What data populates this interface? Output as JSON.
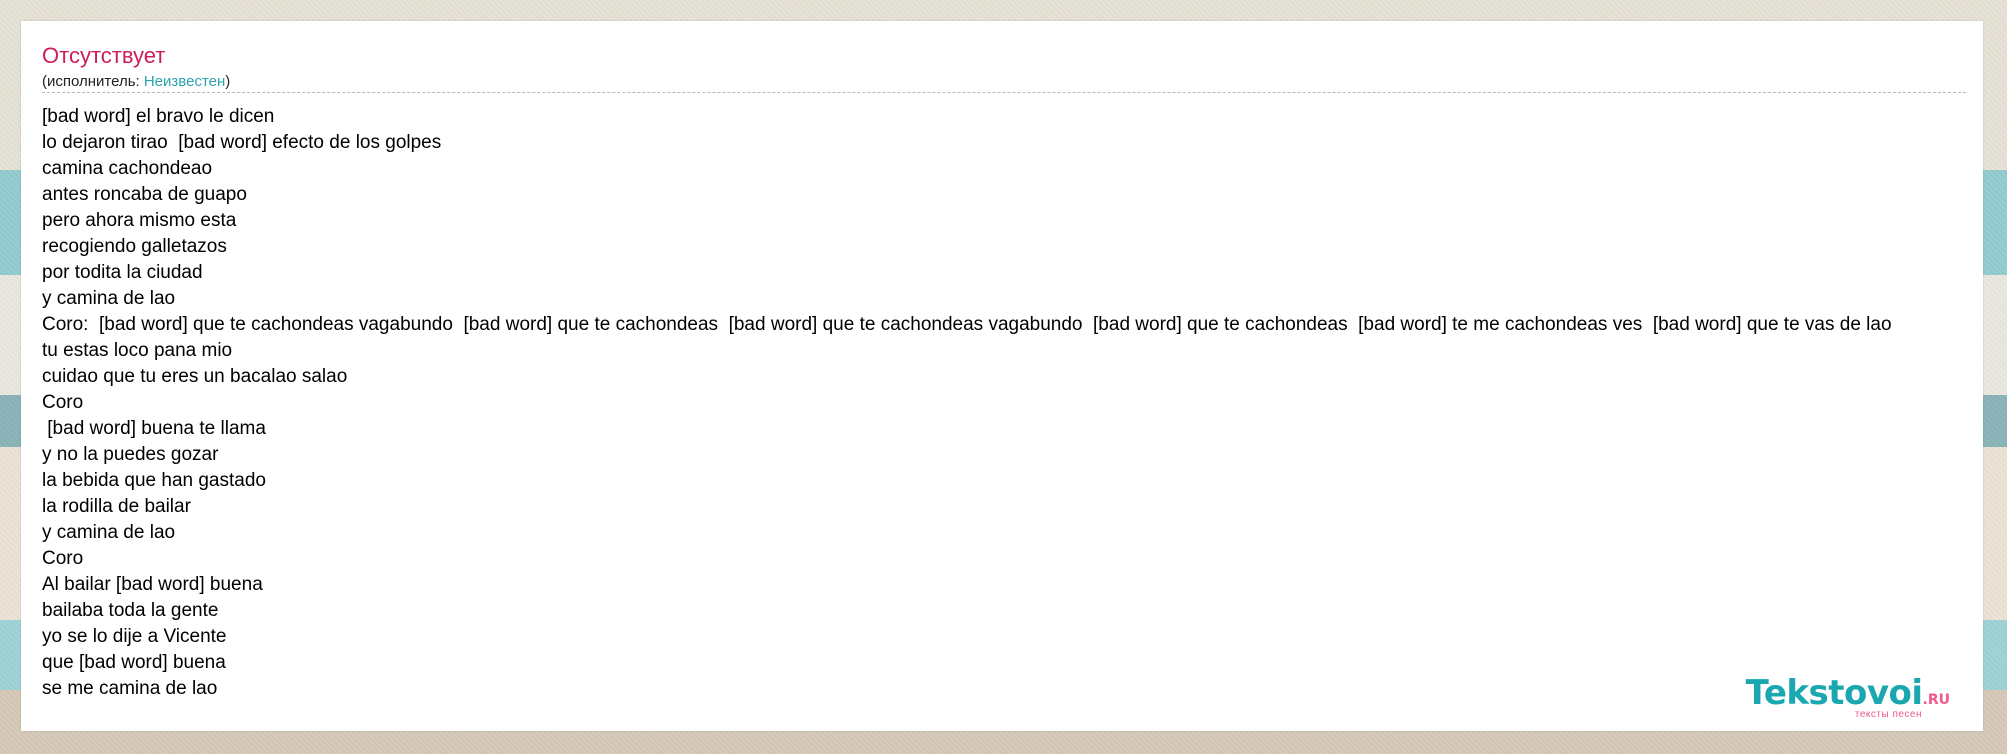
{
  "song": {
    "title": "Отсутствует",
    "artist_prefix": "(исполнитель: ",
    "artist_name": "Неизвестен",
    "artist_suffix": ")"
  },
  "lyrics": [
    "[bad word] el bravo le dicen",
    "lo dejaron tirao  [bad word] efecto de los golpes",
    "camina cachondeao",
    "antes roncaba de guapo",
    "pero ahora mismo esta",
    "recogiendo galletazos",
    "por todita la ciudad",
    "y camina de lao",
    "Coro:  [bad word] que te cachondeas vagabundo  [bad word] que te cachondeas  [bad word] que te cachondeas vagabundo  [bad word] que te cachondeas  [bad word] te me cachondeas ves  [bad word] que te vas de lao",
    "tu estas loco pana mio",
    "cuidao que tu eres un bacalao salao",
    "Coro",
    " [bad word] buena te llama",
    "y no la puedes gozar",
    "la bebida que han gastado",
    "la rodilla de bailar",
    "y camina de lao",
    "Coro",
    "Al bailar [bad word] buena",
    "bailaba toda la gente",
    "yo se lo dije a Vicente",
    "que [bad word] buena",
    "se me camina de lao"
  ],
  "logo": {
    "main": "Tekstovoi",
    "ru": ".RU",
    "tagline": "тексты песен"
  },
  "colors": {
    "title": "#cf1d5a",
    "artist_link": "#2aa3ac",
    "logo_main": "#1aa7af",
    "logo_accent": "#ef5a8a"
  }
}
